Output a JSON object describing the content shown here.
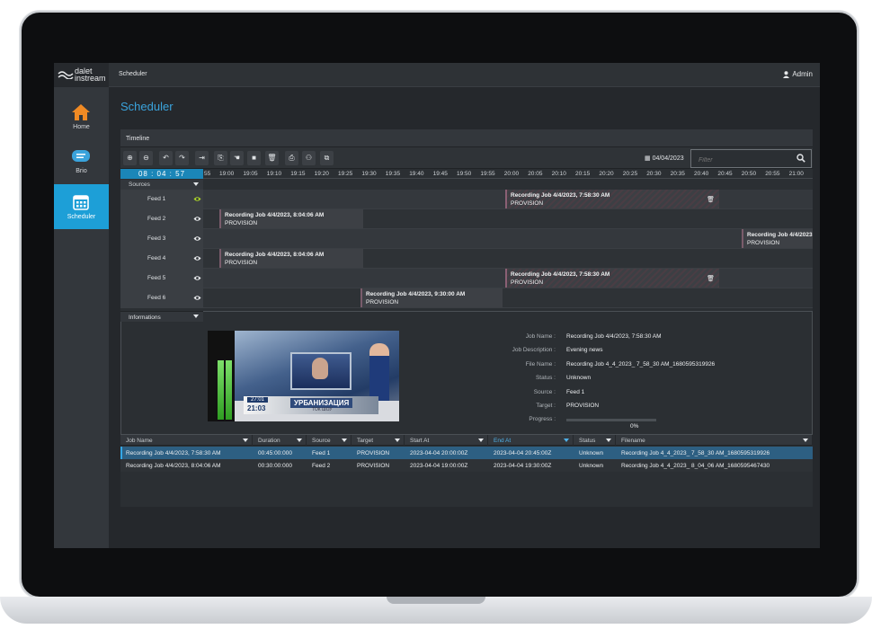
{
  "app": {
    "logo_line1": "dalet",
    "logo_line2": "instream",
    "breadcrumb": "Scheduler",
    "user": "Admin"
  },
  "sidebar": {
    "items": [
      {
        "label": "Home",
        "icon": "home-icon",
        "color": "#f08a24"
      },
      {
        "label": "Brio",
        "icon": "brio-icon",
        "color": "#3aa3dc"
      },
      {
        "label": "Scheduler",
        "icon": "calendar-icon",
        "color": "#ffffff",
        "active": true
      }
    ]
  },
  "page": {
    "title": "Scheduler"
  },
  "timeline": {
    "panel_title": "Timeline",
    "date": "04/04/2023",
    "filter_placeholder": "Filter",
    "clock": "08 : 04 : 57",
    "ticks": [
      "55",
      "19:00",
      "19:05",
      "19:10",
      "19:15",
      "19:20",
      "19:25",
      "19:30",
      "19:35",
      "19:40",
      "19:45",
      "19:50",
      "19:55",
      "20:00",
      "20:05",
      "20:10",
      "20:15",
      "20:20",
      "20:25",
      "20:30",
      "20:35",
      "20:40",
      "20:45",
      "20:50",
      "20:55",
      "21:00"
    ],
    "sources_label": "Sources",
    "feeds": [
      "Feed 1",
      "Feed 2",
      "Feed 3",
      "Feed 4",
      "Feed 5",
      "Feed 6"
    ],
    "jobs": [
      {
        "title": "Recording Job 4/4/2023, 7:58:30 AM",
        "target": "PROVISION"
      },
      {
        "title": "Recording Job 4/4/2023, 8:04:06 AM",
        "target": "PROVISION"
      },
      {
        "title": "Recording Job 4/4/2023, 8:13:3",
        "target": "PROVISION"
      },
      {
        "title": "Recording Job 4/4/2023, 8:04:06 AM",
        "target": "PROVISION"
      },
      {
        "title": "Recording Job 4/4/2023, 7:58:30 AM",
        "target": "PROVISION"
      },
      {
        "title": "Recording Job 4/4/2023, 9:30:00 AM",
        "target": "PROVISION"
      }
    ]
  },
  "informations": {
    "label": "Informations",
    "preview": {
      "clock": "27:01",
      "counter": "21:03",
      "headline": "УРБАНИЗАЦИЯ",
      "subline": "ТОК ШОУ",
      "meter_labels": [
        "-3.5",
        "-2.5",
        "0",
        "-6",
        "-12",
        "-18",
        "-24",
        "-30",
        "-36",
        "-42"
      ]
    },
    "fields": [
      {
        "key": "Job Name :",
        "value": "Recording Job 4/4/2023, 7:58:30 AM"
      },
      {
        "key": "Job Description :",
        "value": "Evening news"
      },
      {
        "key": "File Name :",
        "value": "Recording Job 4_4_2023_ 7_58_30 AM_1680595319926"
      },
      {
        "key": "Status :",
        "value": "Unknown"
      },
      {
        "key": "Source :",
        "value": "Feed 1"
      },
      {
        "key": "Target :",
        "value": "PROVISION"
      }
    ],
    "progress_label": "Progress :",
    "progress_value": "0%",
    "progress_fraction": 0
  },
  "table": {
    "columns": [
      "Job Name",
      "Duration",
      "Source",
      "Target",
      "Start At",
      "End At",
      "Status",
      "Filename"
    ],
    "sorted_column": "End At",
    "rows": [
      [
        "Recording Job 4/4/2023, 7:58:30 AM",
        "00:45:00:000",
        "Feed 1",
        "PROVISION",
        "2023-04-04 20:00:00Z",
        "2023-04-04 20:45:00Z",
        "Unknown",
        "Recording Job 4_4_2023_ 7_58_30 AM_1680595319926"
      ],
      [
        "Recording Job 4/4/2023, 8:04:06 AM",
        "00:30:00:000",
        "Feed 2",
        "PROVISION",
        "2023-04-04 19:00:00Z",
        "2023-04-04 19:30:00Z",
        "Unknown",
        "Recording Job 4_4_2023_ 8_04_06 AM_1680595467430"
      ]
    ]
  }
}
